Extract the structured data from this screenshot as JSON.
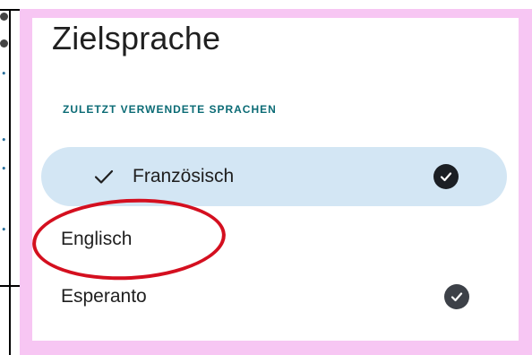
{
  "dialog": {
    "title": "Zielsprache",
    "section_label": "ZULETZT VERWENDETE SPRACHEN",
    "languages": [
      {
        "label": "Französisch",
        "selected": true,
        "downloaded": true
      },
      {
        "label": "Englisch",
        "selected": false,
        "downloaded": false
      },
      {
        "label": "Esperanto",
        "selected": false,
        "downloaded": true
      }
    ]
  },
  "colors": {
    "frame": "#f7c6f3",
    "selected_row": "#d3e6f4",
    "section_label": "#0b6b75",
    "annotation": "#d40f1f"
  },
  "icons": {
    "selected": "checkmark-icon",
    "downloaded": "check-circle-icon"
  }
}
